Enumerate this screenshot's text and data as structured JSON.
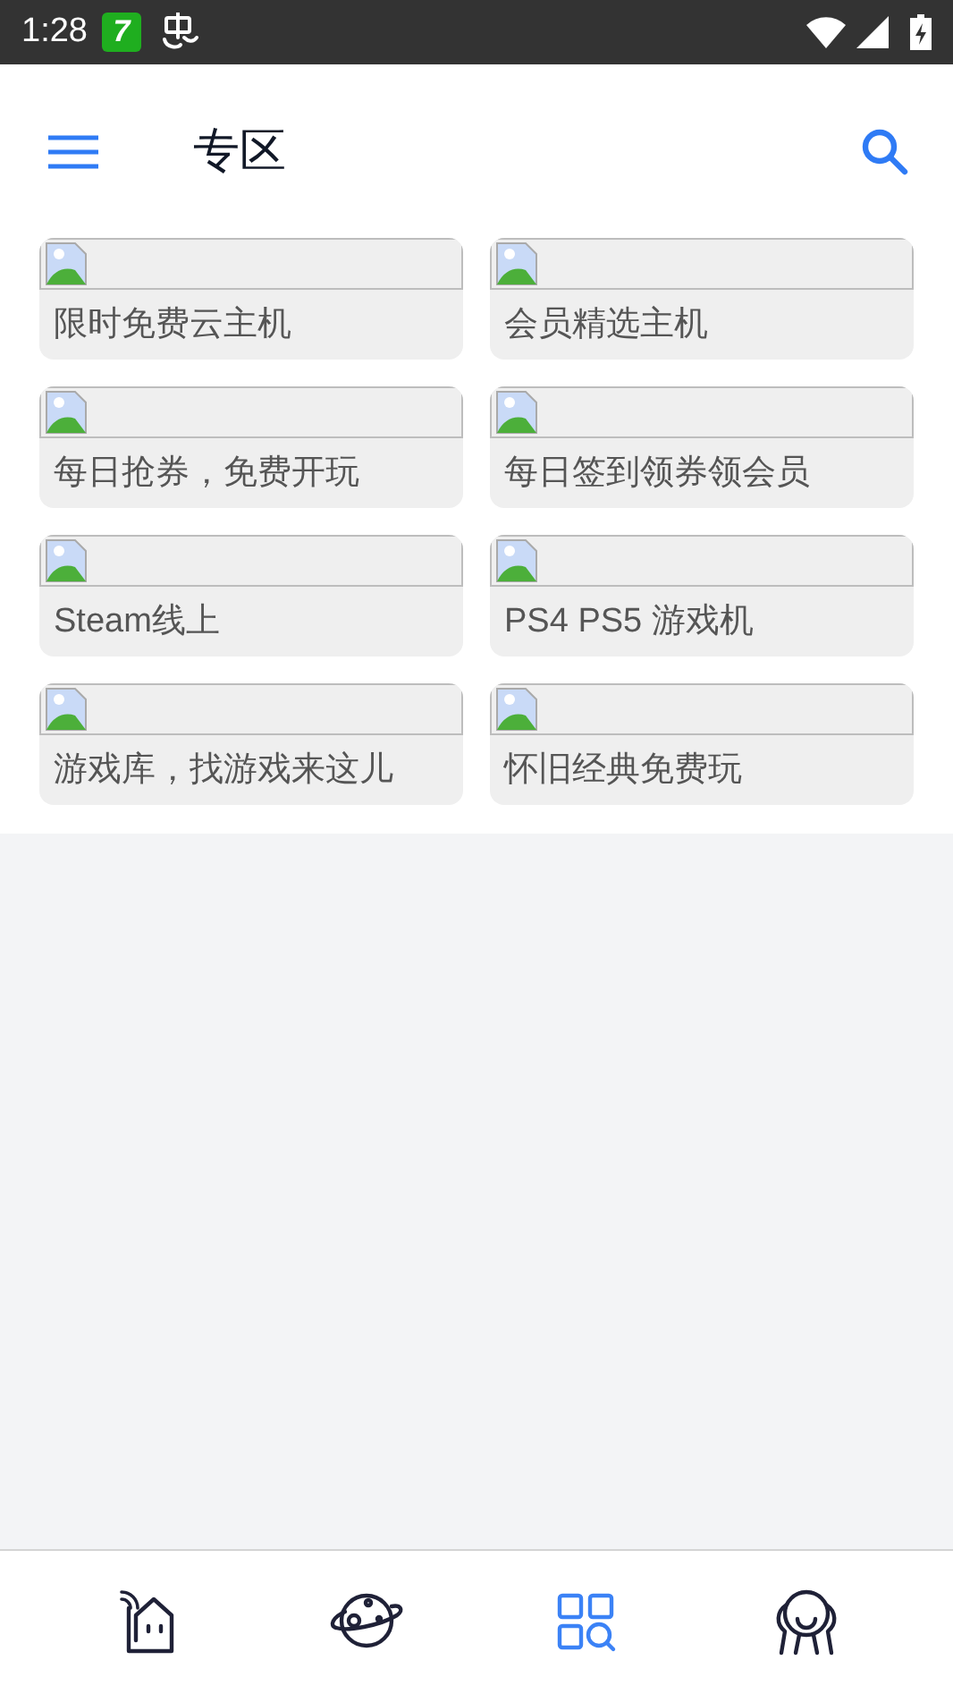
{
  "status_bar": {
    "time": "1:28",
    "app_badge": "7"
  },
  "header": {
    "title": "专区"
  },
  "cards": [
    {
      "label": "限时免费云主机"
    },
    {
      "label": "会员精选主机"
    },
    {
      "label": "每日抢券，免费开玩"
    },
    {
      "label": "每日签到领券领会员"
    },
    {
      "label": "Steam线上"
    },
    {
      "label": "PS4 PS5 游戏机"
    },
    {
      "label": "游戏库，找游戏来这儿"
    },
    {
      "label": "怀旧经典免费玩"
    }
  ],
  "bottom_nav": [
    {
      "kind": "home",
      "selected": false
    },
    {
      "kind": "planet",
      "selected": false
    },
    {
      "kind": "apps",
      "selected": true
    },
    {
      "kind": "profile",
      "selected": false
    }
  ]
}
